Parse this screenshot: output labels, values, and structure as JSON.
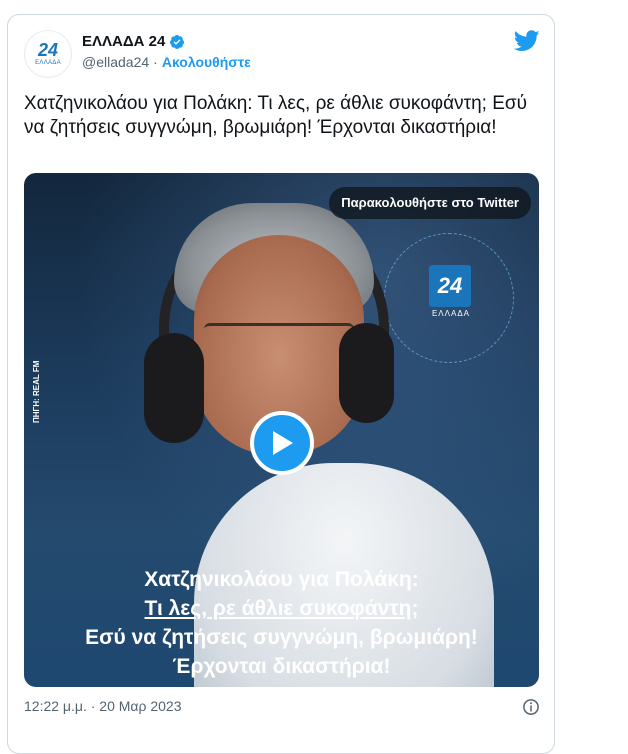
{
  "account": {
    "name": "ΕΛΛΑΔΑ 24",
    "handle": "@ellada24",
    "separator": "·",
    "follow_label": "Ακολουθήστε",
    "avatar_text": "24",
    "avatar_subtext": "ΕΛΛΑΔΑ"
  },
  "icons": {
    "verified": "verified-badge-icon",
    "platform": "twitter-bird-icon",
    "info": "info-icon",
    "play": "play-icon"
  },
  "colors": {
    "accent": "#1d9bf0",
    "brand": "#1b75bb",
    "text": "#0f1419",
    "muted": "#536471"
  },
  "tweet": {
    "text": "Χατζηνικολάου για Πολάκη: Τι λες, ρε άθλιε συκοφάντη; Εσύ να ζητήσεις συγγνώμη, βρωμιάρη! Έρχονται δικαστήρια!"
  },
  "media": {
    "watch_label": "Παρακολουθήστε στο Twitter",
    "source_label": "ΠΗΓΗ: REAL FM",
    "logo_text": "24",
    "logo_subtext": "ΕΛΛΑΔΑ",
    "overlay_line1": "Χατζηνικολάου για Πολάκη:",
    "overlay_line2": "Τι λες, ρε άθλιε συκοφάντη;",
    "overlay_line3": "Εσύ να ζητήσεις συγγνώμη, βρωμιάρη!",
    "overlay_line4": "Έρχονται δικαστήρια!"
  },
  "footer": {
    "timestamp": "12:22 μ.μ. · 20 Μαρ 2023"
  }
}
